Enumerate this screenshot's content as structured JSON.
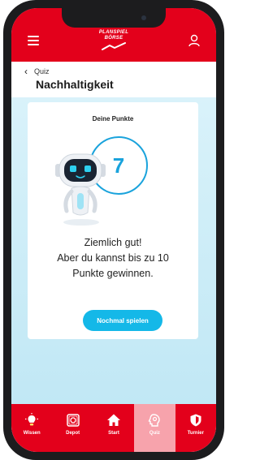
{
  "app": {
    "logo_line1": "PLANSPIEL",
    "logo_line2": "BÖRSE"
  },
  "header": {
    "back_label": "Quiz",
    "title": "Nachhaltigkeit"
  },
  "result": {
    "points_label": "Deine Punkte",
    "score": "7",
    "line1": "Ziemlich gut!",
    "line2": "Aber du kannst bis zu 10",
    "line3": "Punkte gewinnen.",
    "button_label": "Nochmal spielen"
  },
  "nav": {
    "items": [
      {
        "label": "Wissen",
        "icon": "lightbulb-icon"
      },
      {
        "label": "Depot",
        "icon": "safe-icon"
      },
      {
        "label": "Start",
        "icon": "home-icon"
      },
      {
        "label": "Quiz",
        "icon": "quiz-head-icon",
        "active": true
      },
      {
        "label": "Turnier",
        "icon": "shield-icon"
      }
    ]
  },
  "colors": {
    "brand_red": "#e3001b",
    "accent_blue": "#14b8e8",
    "active_nav": "#f7a3ac"
  }
}
